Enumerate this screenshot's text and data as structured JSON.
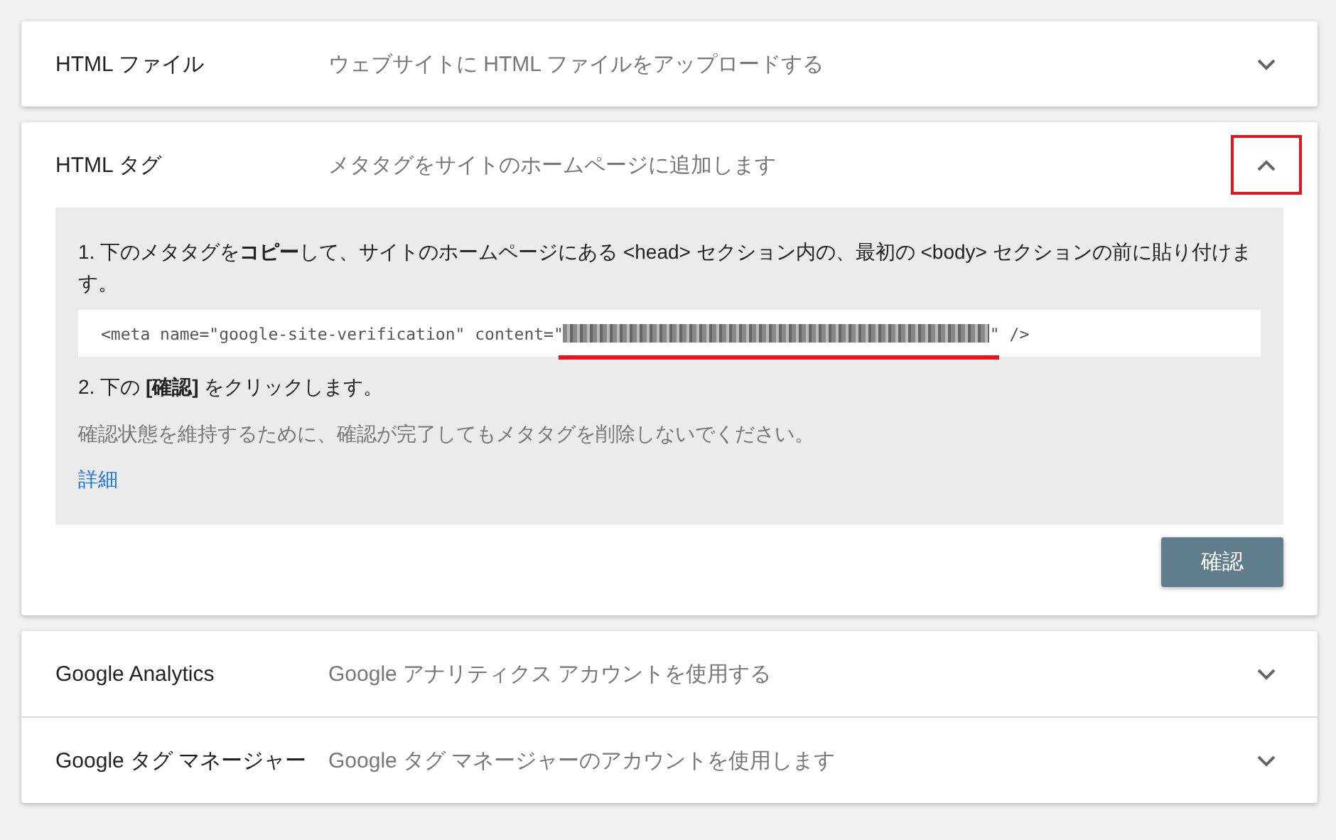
{
  "groups": [
    {
      "sections": [
        {
          "title": "HTML ファイル",
          "description": "ウェブサイトに HTML ファイルをアップロードする",
          "expanded": false
        }
      ]
    },
    {
      "sections": [
        {
          "title": "HTML タグ",
          "description": "メタタグをサイトのホームページに追加します",
          "expanded": true,
          "content": {
            "step_1": "1. 下のメタタグを**コピー**して、サイトのホームページにある <head> セクション内の、最初の <body> セクションの前に貼り付けます。",
            "code_start": "<meta name=\"google-site-verification\" content=\"",
            "code_end": "\" />",
            "step_2": "2. 下の **[確認]** をクリックします。",
            "note": "確認状態を維持するために、確認が完了してもメタタグを削除しないでください。",
            "link": "詳細",
            "button": "確認"
          }
        }
      ]
    },
    {
      "sections": [
        {
          "title": "Google Analytics",
          "description": "Google アナリティクス アカウントを使用する",
          "expanded": false
        },
        {
          "title": "Google タグ マネージャー",
          "description": "Google タグ マネージャーのアカウントを使用します",
          "expanded": false
        }
      ]
    }
  ]
}
